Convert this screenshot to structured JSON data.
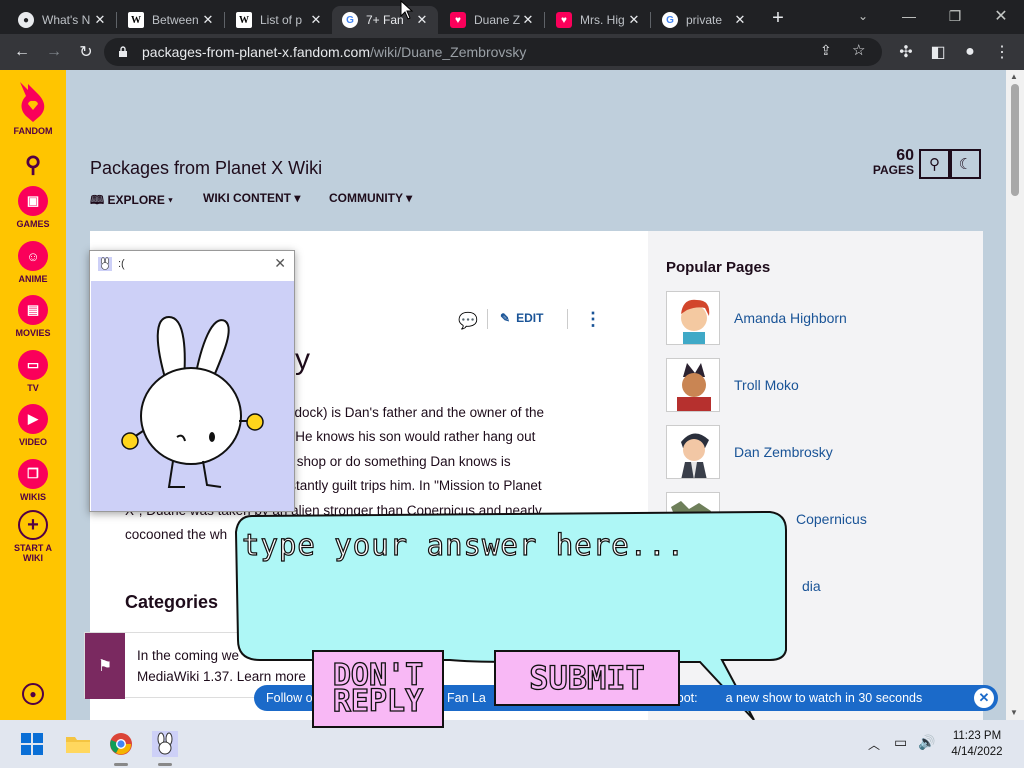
{
  "browser": {
    "tabs": [
      {
        "title": "What's N",
        "favicon": "chrome-favicon-icon",
        "active": false
      },
      {
        "title": "Between",
        "favicon": "wikipedia-favicon-icon",
        "active": false
      },
      {
        "title": "List of p",
        "favicon": "wikipedia-favicon-icon",
        "active": false
      },
      {
        "title": "7+ Fan",
        "favicon": "google-favicon-icon",
        "active": true
      },
      {
        "title": "Duane Z",
        "favicon": "fandom-favicon-icon",
        "active": false
      },
      {
        "title": "Mrs. Hig",
        "favicon": "fandom-favicon-icon",
        "active": false
      },
      {
        "title": "private",
        "favicon": "google-favicon-icon",
        "active": false
      }
    ],
    "new_tab": "+",
    "url_host": "packages-from-planet-x.fandom.com",
    "url_path": "/wiki/Duane_Zembrovsky"
  },
  "fandom_rail": {
    "logo_label": "FANDOM",
    "items": [
      {
        "label": "GAMES",
        "icon": "gamepad-icon"
      },
      {
        "label": "ANIME",
        "icon": "anime-icon"
      },
      {
        "label": "MOVIES",
        "icon": "movies-icon"
      },
      {
        "label": "TV",
        "icon": "tv-icon"
      },
      {
        "label": "VIDEO",
        "icon": "video-icon"
      },
      {
        "label": "WIKIS",
        "icon": "wikis-icon"
      }
    ],
    "start_wiki_line1": "START A",
    "start_wiki_line2": "WIKI"
  },
  "wiki": {
    "title": "Packages from Planet X Wiki",
    "nav": [
      "EXPLORE",
      "WIKI CONTENT",
      "COMMUNITY"
    ],
    "pages_count": "60",
    "pages_label": "PAGES"
  },
  "article": {
    "title_fragment": "ky",
    "edit_label": "EDIT",
    "lines": [
      "n Murdock) is Dan's father and the owner of the",
      "ocks. He knows his son would rather hang out",
      "in the shop or do something Dan knows is",
      "t constantly guilt trips him. In \"Mission to Planet",
      "X\", Duane was taken by an alien stronger than Coperpicus and nearly",
      "cocooned the wh"
    ],
    "categories_heading": "Categories"
  },
  "popular_pages": {
    "heading": "Popular Pages",
    "items": [
      "Amanda Highborn",
      "Troll Moko",
      "Dan Zembrosky",
      "Copernicus",
      "dia"
    ]
  },
  "notice": {
    "line1": "In the coming we",
    "line2": "MediaWiki 1.37. Learn more"
  },
  "follow_bar": {
    "part1": "Follow o",
    "part2": "n Fan La",
    "part3": "ngebot: ",
    "part4": "a new show to watch in 30 seconds"
  },
  "popup": {
    "title": ":("
  },
  "bubble": {
    "placeholder": "type your answer here...",
    "dont_reply_line1": "DON'T",
    "dont_reply_line2": "REPLY",
    "submit_label": "SUBMIT",
    "fill_color": "#aef7f6"
  },
  "taskbar": {
    "time": "11:23 PM",
    "date": "4/14/2022"
  }
}
